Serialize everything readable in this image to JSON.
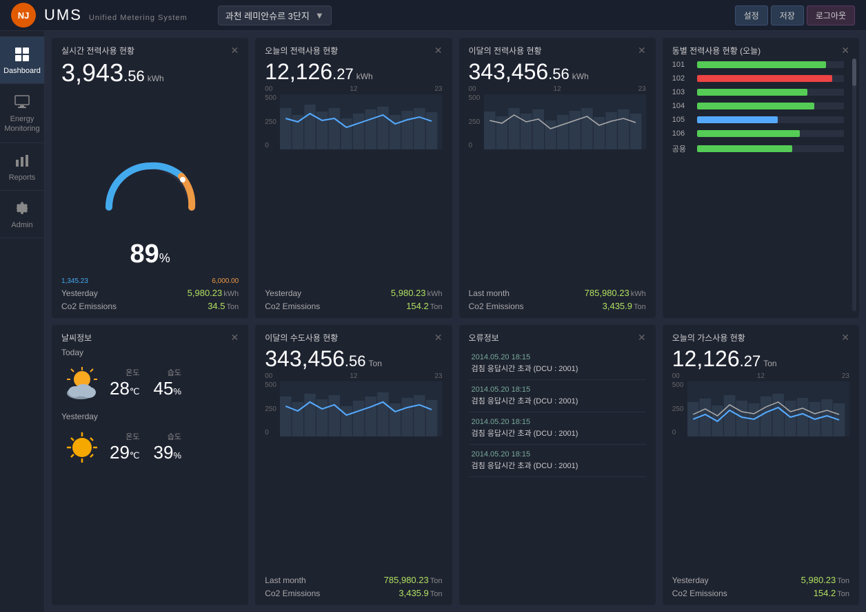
{
  "topbar": {
    "logo": "NJ",
    "title": "UMS",
    "subtitle_u": "U",
    "subtitle_m": "M",
    "subtitle_s": "S",
    "subtitle_rest": "nified etering ystem",
    "subtitle_full": "Unified Metering System",
    "site": "과천 레미안슈르 3단지",
    "buttons": {
      "settings": "설정",
      "save": "저장",
      "logout": "로그아웃"
    }
  },
  "sidebar": {
    "items": [
      {
        "label": "Dashboard",
        "icon": "grid"
      },
      {
        "label": "Energy\nMonitoring",
        "icon": "monitor"
      },
      {
        "label": "Reports",
        "icon": "bar-chart"
      },
      {
        "label": "Admin",
        "icon": "gear"
      }
    ]
  },
  "cards": {
    "realtime": {
      "title": "실시간 전력사용 현황",
      "value": "3,943",
      "decimal": "56",
      "unit": "kWh",
      "gauge_pct": "89",
      "gauge_min": "1,345.23",
      "gauge_max": "6,000.00",
      "yesterday_label": "Yesterday",
      "yesterday_value": "5,980.23",
      "yesterday_unit": "kWh",
      "co2_label": "Co2 Emissions",
      "co2_value": "34.5",
      "co2_unit": "Ton"
    },
    "today": {
      "title": "오늘의 전력사용 현황",
      "value": "12,126",
      "decimal": "27",
      "unit": "kWh",
      "yesterday_label": "Yesterday",
      "yesterday_value": "5,980.23",
      "yesterday_unit": "kWh",
      "co2_label": "Co2 Emissions",
      "co2_value": "154.2",
      "co2_unit": "Ton",
      "chart_x": [
        "00",
        "12",
        "23"
      ],
      "chart_y": [
        "500",
        "250",
        "0"
      ]
    },
    "monthly": {
      "title": "이달의 전력사용 현황",
      "value": "343,456",
      "decimal": "56",
      "unit": "kWh",
      "lastmonth_label": "Last month",
      "lastmonth_value": "785,980.23",
      "lastmonth_unit": "kWh",
      "co2_label": "Co2 Emissions",
      "co2_value": "3,435.9",
      "co2_unit": "Ton",
      "chart_x": [
        "00",
        "12",
        "23"
      ],
      "chart_y": [
        "500",
        "250",
        "0"
      ]
    },
    "building": {
      "title": "동별 전력사용 현황 (오늘)",
      "rows": [
        {
          "label": "101",
          "pct": 88,
          "color": "#5c5"
        },
        {
          "label": "102",
          "pct": 92,
          "color": "#e44"
        },
        {
          "label": "103",
          "pct": 75,
          "color": "#5c5"
        },
        {
          "label": "104",
          "pct": 80,
          "color": "#5c5"
        },
        {
          "label": "105",
          "pct": 55,
          "color": "#5af"
        },
        {
          "label": "106",
          "pct": 70,
          "color": "#5c5"
        },
        {
          "label": "공용",
          "pct": 65,
          "color": "#5c5"
        }
      ]
    },
    "weather": {
      "title": "날씨정보",
      "today_label": "Today",
      "today_temp_label": "온도",
      "today_temp": "28",
      "today_temp_unit": "℃",
      "today_hum_label": "습도",
      "today_hum": "45",
      "today_hum_unit": "%",
      "yesterday_label": "Yesterday",
      "yesterday_temp_label": "온도",
      "yesterday_temp": "29",
      "yesterday_temp_unit": "℃",
      "yesterday_hum_label": "습도",
      "yesterday_hum": "39",
      "yesterday_hum_unit": "%"
    },
    "water": {
      "title": "이달의 수도사용 현황",
      "value": "343,456",
      "decimal": "56",
      "unit": "Ton",
      "lastmonth_label": "Last month",
      "lastmonth_value": "785,980.23",
      "lastmonth_unit": "Ton",
      "co2_label": "Co2 Emissions",
      "co2_value": "3,435.9",
      "co2_unit": "Ton",
      "chart_x": [
        "00",
        "12",
        "23"
      ],
      "chart_y": [
        "500",
        "250",
        "0"
      ]
    },
    "errors": {
      "title": "오류정보",
      "items": [
        {
          "time": "2014.05.20 18:15",
          "msg": "검침 응답시간 초과 (DCU : 2001)"
        },
        {
          "time": "2014.05.20 18:15",
          "msg": "검침 응답시간 초과 (DCU : 2001)"
        },
        {
          "time": "2014.05.20 18:15",
          "msg": "검침 응답시간 초과 (DCU : 2001)"
        },
        {
          "time": "2014.05.20 18:15",
          "msg": "검침 응답시간 초과 (DCU : 2001)"
        }
      ]
    },
    "gas": {
      "title": "오늘의 가스사용 현황",
      "value": "12,126",
      "decimal": "27",
      "unit": "Ton",
      "yesterday_label": "Yesterday",
      "yesterday_value": "5,980.23",
      "yesterday_unit": "Ton",
      "co2_label": "Co2 Emissions",
      "co2_value": "154.2",
      "co2_unit": "Ton",
      "chart_x": [
        "00",
        "12",
        "23"
      ],
      "chart_y": [
        "500",
        "250",
        "0"
      ]
    }
  }
}
